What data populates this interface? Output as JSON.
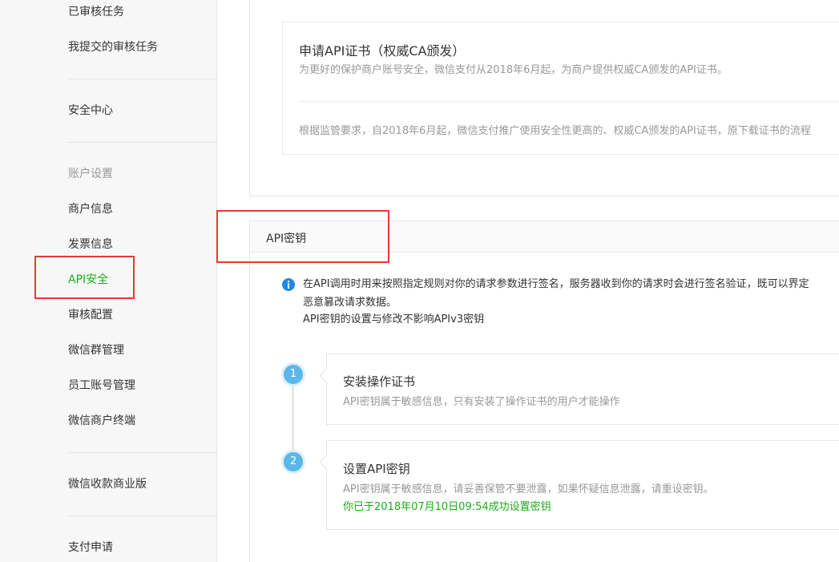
{
  "sidebar": {
    "items": [
      {
        "label": "已审核任务"
      },
      {
        "label": "我提交的审核任务"
      },
      {
        "label": "安全中心"
      },
      {
        "label": "账户设置"
      },
      {
        "label": "商户信息"
      },
      {
        "label": "发票信息"
      },
      {
        "label": "API安全"
      },
      {
        "label": "审核配置"
      },
      {
        "label": "微信群管理"
      },
      {
        "label": "员工账号管理"
      },
      {
        "label": "微信商户终端"
      },
      {
        "label": "微信收款商业版"
      },
      {
        "label": "支付申请"
      }
    ]
  },
  "certificate": {
    "title": "申请API证书（权威CA颁发）",
    "desc": "为更好的保护商户账号安全，微信支付从2018年6月起，为商户提供权威CA颁发的API证书。",
    "note": "根据监管要求，自2018年6月起，微信支付推广使用安全性更高的、权威CA颁发的API证书，原下载证书的流程"
  },
  "api_key": {
    "title": "API密钥",
    "info_lines": [
      "在API调用时用来按照指定规则对你的请求参数进行签名，服务器收到你的请求时会进行签名验证，既可以界定",
      "恶意篡改请求数据。",
      "API密钥的设置与修改不影响APIv3密钥"
    ],
    "steps": [
      {
        "number": "1",
        "title": "安装操作证书",
        "desc": "API密钥属于敏感信息，只有安装了操作证书的用户才能操作"
      },
      {
        "number": "2",
        "title": "设置API密钥",
        "desc": "API密钥属于敏感信息，请妥善保管不要泄露，如果怀疑信息泄露，请重设密钥。",
        "status": "你已于2018年07月10日09:54成功设置密钥"
      }
    ]
  },
  "colors": {
    "active_green": "#1aad19",
    "annotation_red": "#e53935",
    "step_blue": "#5bb7e9",
    "info_blue": "#1e88e5"
  }
}
